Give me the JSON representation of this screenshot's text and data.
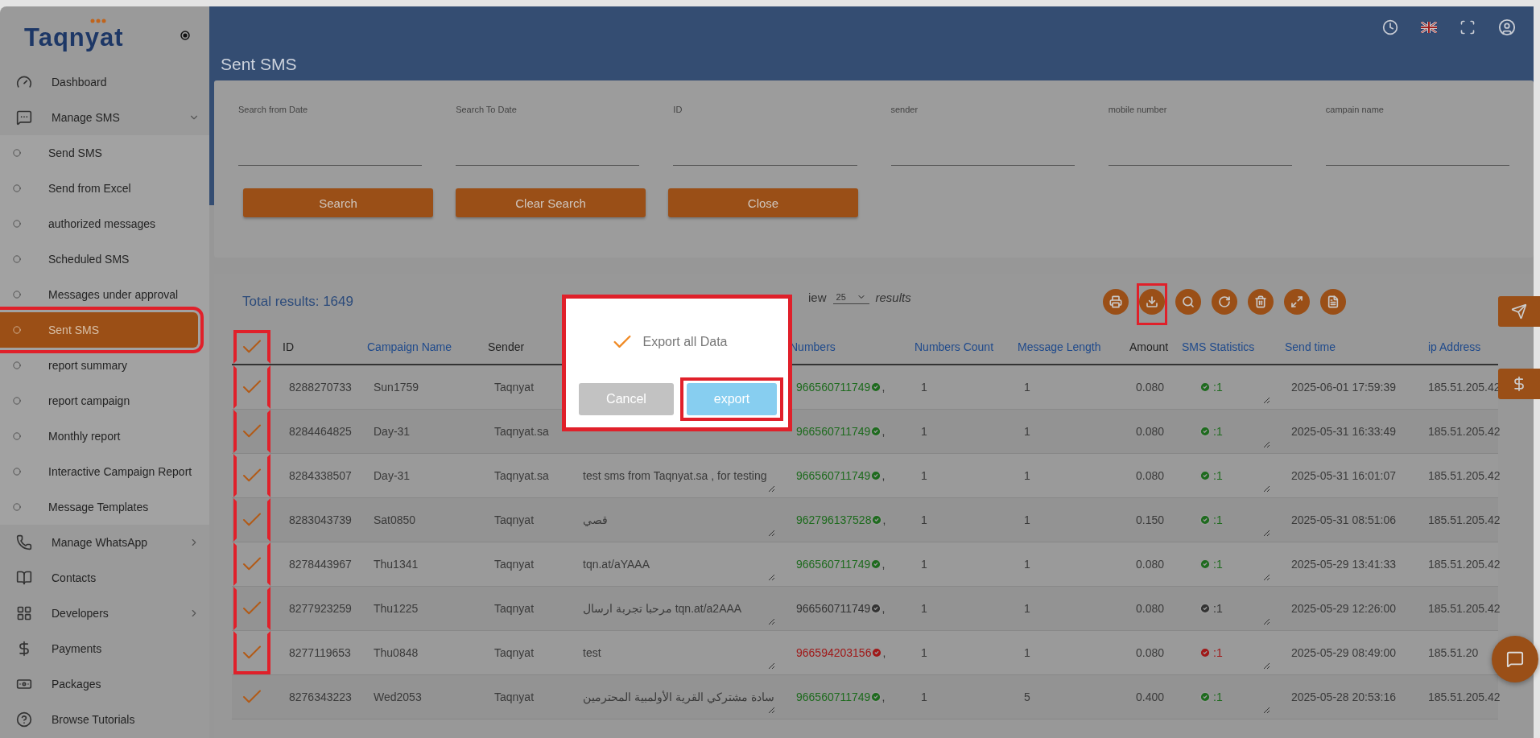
{
  "sidebar": {
    "logo": "Taqnyat",
    "items": [
      {
        "label": "Dashboard",
        "kind": "link"
      },
      {
        "label": "Manage SMS",
        "kind": "group",
        "expanded": true,
        "children": [
          {
            "label": "Send SMS",
            "selected": false,
            "highlighted": false
          },
          {
            "label": "Send from Excel",
            "selected": false,
            "highlighted": false
          },
          {
            "label": "authorized messages",
            "selected": false,
            "highlighted": false
          },
          {
            "label": "Scheduled SMS",
            "selected": false,
            "highlighted": false
          },
          {
            "label": "Messages under approval",
            "selected": false,
            "highlighted": false
          },
          {
            "label": "Sent SMS",
            "selected": true,
            "highlighted": true
          },
          {
            "label": "report summary",
            "selected": false,
            "highlighted": false
          },
          {
            "label": "report campaign",
            "selected": false,
            "highlighted": false
          },
          {
            "label": "Monthly report",
            "selected": false,
            "highlighted": false
          },
          {
            "label": "Interactive Campaign Report",
            "selected": false,
            "highlighted": false
          },
          {
            "label": "Message Templates",
            "selected": false,
            "highlighted": false
          }
        ]
      },
      {
        "label": "Manage WhatsApp",
        "kind": "group",
        "expanded": false
      },
      {
        "label": "Contacts",
        "kind": "link"
      },
      {
        "label": "Developers",
        "kind": "group",
        "expanded": false
      },
      {
        "label": "Payments",
        "kind": "link"
      },
      {
        "label": "Packages",
        "kind": "link"
      },
      {
        "label": "Browse Tutorials",
        "kind": "link"
      }
    ]
  },
  "page_title": "Sent SMS",
  "filters": {
    "fields": [
      {
        "label": "Search from Date"
      },
      {
        "label": "Search To Date"
      },
      {
        "label": "ID"
      },
      {
        "label": "sender"
      },
      {
        "label": "mobile number"
      },
      {
        "label": "campain name"
      }
    ],
    "buttons": [
      "Search",
      "Clear Search",
      "Close"
    ]
  },
  "results": {
    "total": "Total results: 1649",
    "page_size_prefix": "iew",
    "page_size": "25",
    "page_size_suffix": "results"
  },
  "toolbar": [
    {
      "highlighted": false
    },
    {
      "highlighted": true
    },
    {
      "highlighted": false
    },
    {
      "highlighted": false
    },
    {
      "highlighted": false
    },
    {
      "highlighted": false
    },
    {
      "highlighted": false
    }
  ],
  "table": {
    "header_checked": true,
    "header_highlighted": true,
    "columns": [
      {
        "label": "ID",
        "sortable": false
      },
      {
        "label": "Campaign Name",
        "sortable": true
      },
      {
        "label": "Sender",
        "sortable": false
      },
      {
        "label": "Numbers",
        "sortable": true
      },
      {
        "label": "Numbers Count",
        "sortable": true
      },
      {
        "label": "Message Length",
        "sortable": true
      },
      {
        "label": "Amount",
        "sortable": false
      },
      {
        "label": "SMS Statistics",
        "sortable": true
      },
      {
        "label": "Send time",
        "sortable": true
      },
      {
        "label": "ip Address",
        "sortable": true
      }
    ],
    "rows": [
      {
        "checked": true,
        "highlighted": true,
        "id": "8288270733",
        "campaign": "Sun1759",
        "sender": "Taqnyat",
        "number": "966560711749",
        "separator": ",",
        "color": "#1e6b1e",
        "count": "1",
        "length": "1",
        "amount": "0.080",
        "stats": ":1",
        "send_time": "2025-06-01 17:59:39",
        "ip": "185.51.205.42"
      },
      {
        "checked": true,
        "highlighted": true,
        "id": "8284464825",
        "campaign": "Day-31",
        "sender": "Taqnyat.sa",
        "number": "966560711749",
        "separator": ",",
        "color": "#1e6b1e",
        "count": "1",
        "length": "1",
        "amount": "0.080",
        "stats": ":1",
        "send_time": "2025-05-31 16:33:49",
        "ip": "185.51.205.42"
      },
      {
        "checked": true,
        "highlighted": true,
        "id": "8284338507",
        "campaign": "Day-31",
        "sender": "Taqnyat.sa",
        "message": "test sms from Taqnyat.sa , for testing",
        "number": "966560711749",
        "separator": ",",
        "color": "#1e6b1e",
        "count": "1",
        "length": "1",
        "amount": "0.080",
        "stats": ":1",
        "send_time": "2025-05-31 16:01:07",
        "ip": "185.51.205.42"
      },
      {
        "checked": true,
        "highlighted": true,
        "id": "8283043739",
        "campaign": "Sat0850",
        "sender": "Taqnyat",
        "message": "قصي",
        "number": "962796137528",
        "separator": ",",
        "color": "#1e6b1e",
        "count": "1",
        "length": "1",
        "amount": "0.150",
        "stats": ":1",
        "send_time": "2025-05-31 08:51:06",
        "ip": "185.51.205.42"
      },
      {
        "checked": true,
        "highlighted": true,
        "id": "8278443967",
        "campaign": "Thu1341",
        "sender": "Taqnyat",
        "message": "tqn.at/aYAAA",
        "number": "966560711749",
        "separator": ",",
        "color": "#1e6b1e",
        "count": "1",
        "length": "1",
        "amount": "0.080",
        "stats": ":1",
        "send_time": "2025-05-29 13:41:33",
        "ip": "185.51.205.42"
      },
      {
        "checked": true,
        "highlighted": true,
        "id": "8277923259",
        "campaign": "Thu1225",
        "sender": "Taqnyat",
        "message": "مرحبا تجربة ارسال tqn.at/a2AAA",
        "number": "966560711749",
        "separator": ",",
        "color": "#333333",
        "count": "1",
        "length": "1",
        "amount": "0.080",
        "stats": ":1",
        "send_time": "2025-05-29 12:26:00",
        "ip": "185.51.205.42"
      },
      {
        "checked": true,
        "highlighted": true,
        "id": "8277119653",
        "campaign": "Thu0848",
        "sender": "Taqnyat",
        "message": "test",
        "number": "966594203156",
        "separator": ",",
        "color": "#a01818",
        "count": "1",
        "length": "1",
        "amount": "0.080",
        "stats": ":1",
        "send_time": "2025-05-29 08:49:00",
        "ip": "185.51.20"
      },
      {
        "checked": true,
        "highlighted": false,
        "id": "8276343223",
        "campaign": "Wed2053",
        "sender": "Taqnyat",
        "message": "سادة مشتركي القرية الأولمبية المحترمين",
        "number": "966560711749",
        "separator": ",",
        "color": "#1e6b1e",
        "count": "1",
        "length": "5",
        "amount": "0.400",
        "stats": ":1",
        "send_time": "2025-05-28 20:53:16",
        "ip": "185.51.205.42"
      }
    ]
  },
  "dialog": {
    "highlighted": true,
    "message": "Export all Data",
    "cancel": "Cancel",
    "confirm": "export",
    "confirm_highlighted": true
  }
}
